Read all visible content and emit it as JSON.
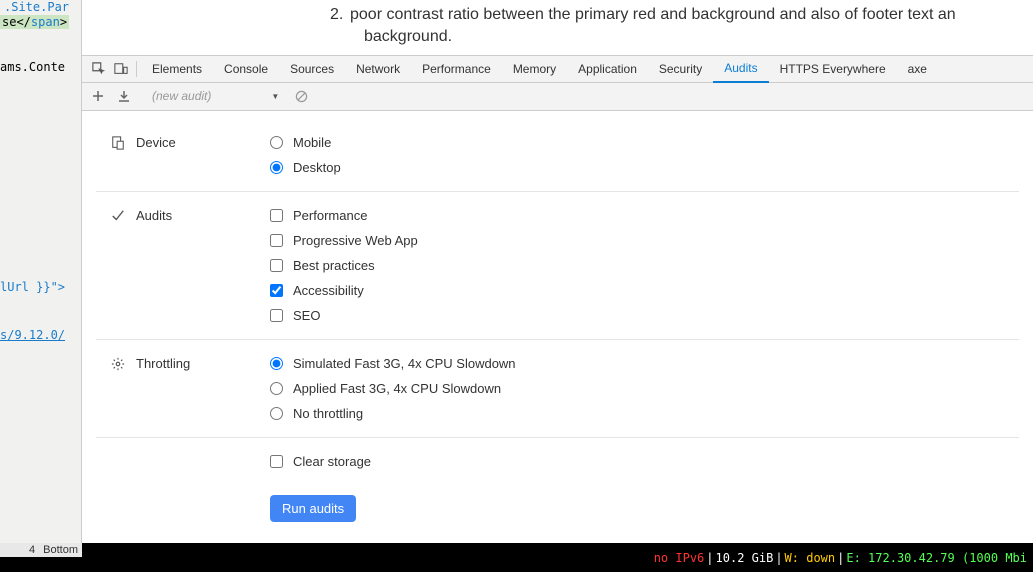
{
  "left_panel": {
    "frag1": ".Site.Par",
    "frag2_pre": "se</",
    "frag2_tag": "span",
    "frag2_post": ">",
    "frag3": "ams.Conte",
    "frag4": "lUrl }}\">",
    "frag5": "s/9.12.0/",
    "frag6_num": "4",
    "frag6_label": "Bottom"
  },
  "doc_text": {
    "item_number": "2.",
    "line1": "poor contrast ratio between the primary red and background and also of footer text an",
    "line2": "background."
  },
  "tabs": {
    "items": [
      "Elements",
      "Console",
      "Sources",
      "Network",
      "Performance",
      "Memory",
      "Application",
      "Security",
      "Audits",
      "HTTPS Everywhere",
      "axe"
    ],
    "active_index": 8
  },
  "toolbar": {
    "dropdown_placeholder": "(new audit)"
  },
  "sections": {
    "device": {
      "label": "Device",
      "options": [
        "Mobile",
        "Desktop"
      ],
      "selected_index": 1
    },
    "audits": {
      "label": "Audits",
      "options": [
        "Performance",
        "Progressive Web App",
        "Best practices",
        "Accessibility",
        "SEO"
      ],
      "checked": [
        false,
        false,
        false,
        true,
        false
      ]
    },
    "throttling": {
      "label": "Throttling",
      "options": [
        "Simulated Fast 3G, 4x CPU Slowdown",
        "Applied Fast 3G, 4x CPU Slowdown",
        "No throttling"
      ],
      "selected_index": 0
    },
    "clear_storage": {
      "label": "Clear storage",
      "checked": false
    },
    "run_button": "Run audits"
  },
  "statusbar": {
    "left_num": "4",
    "left_label": "Bottom",
    "no_ipv6": "no IPv6",
    "mem": "10.2 GiB",
    "wifi": "W: down",
    "eth_prefix": "E: ",
    "eth_ip": "172.30.42.79 (1000 Mbi"
  }
}
